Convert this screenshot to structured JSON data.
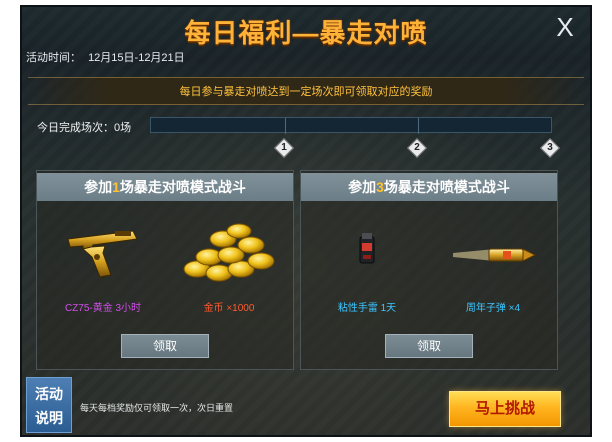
{
  "dialog": {
    "title": "每日福利—暴走对喷",
    "close_symbol": "X",
    "time_label": "活动时间：",
    "time_range": "12月15日-12月21日",
    "banner": "每日参与暴走对喷达到一定场次即可领取对应的奖励"
  },
  "progress": {
    "label": "今日完成场次：0场",
    "completed": 0,
    "milestones": [
      "1",
      "2",
      "3"
    ],
    "colors": {
      "fill": "#2f87c8",
      "track": "#142634"
    }
  },
  "cards": [
    {
      "header_prefix": "参加",
      "header_count": "1",
      "header_suffix": "场暴走对喷模式战斗",
      "items": [
        {
          "name": "CZ75-黄金 3小时",
          "icon": "golden-pistol-icon",
          "color": "#d04ee8"
        },
        {
          "name": "金币 ×1000",
          "icon": "gold-coins-icon",
          "color": "#ff5a2e"
        }
      ],
      "claim_label": "领取"
    },
    {
      "header_prefix": "参加",
      "header_count": "3",
      "header_suffix": "场暴走对喷模式战斗",
      "items": [
        {
          "name": "粘性手雷 1天",
          "icon": "sticky-grenade-icon",
          "color": "#3cc5ff"
        },
        {
          "name": "周年子弹 ×4",
          "icon": "anniversary-bullet-icon",
          "color": "#3cc5ff"
        }
      ],
      "claim_label": "领取"
    }
  ],
  "footer": {
    "explain_line1": "活动",
    "explain_line2": "说明",
    "note": "每天每档奖励仅可领取一次，次日重置",
    "challenge_label": "马上挑战"
  },
  "accent_colors": {
    "title": "#ffb238",
    "highlight": "#ffc22d",
    "challenge_text": "#b31800"
  }
}
